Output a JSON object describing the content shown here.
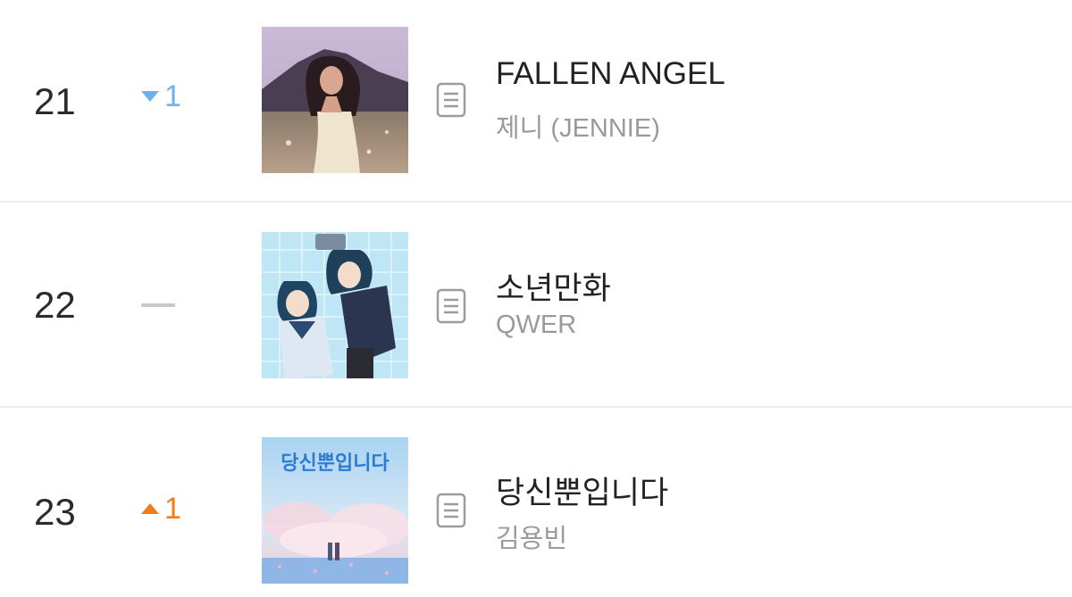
{
  "chart": {
    "rows": [
      {
        "rank": "21",
        "change_direction": "down",
        "change_value": "1",
        "title": "FALLEN ANGEL",
        "artist": "제니 (JENNIE)",
        "lyrics_icon": "lyrics-document-icon"
      },
      {
        "rank": "22",
        "change_direction": "same",
        "change_value": "",
        "title": "소년만화",
        "artist": "QWER",
        "lyrics_icon": "lyrics-document-icon"
      },
      {
        "rank": "23",
        "change_direction": "up",
        "change_value": "1",
        "title": "당신뿐입니다",
        "artist": "김용빈",
        "cover_text": "당신뿐입니다",
        "lyrics_icon": "lyrics-document-icon"
      }
    ]
  },
  "colors": {
    "rank_down": "#6fb0ef",
    "rank_up": "#f07d1a",
    "rank_same": "#c9c9c9",
    "title": "#222222",
    "artist": "#9a9a9a",
    "divider": "#ededed"
  }
}
